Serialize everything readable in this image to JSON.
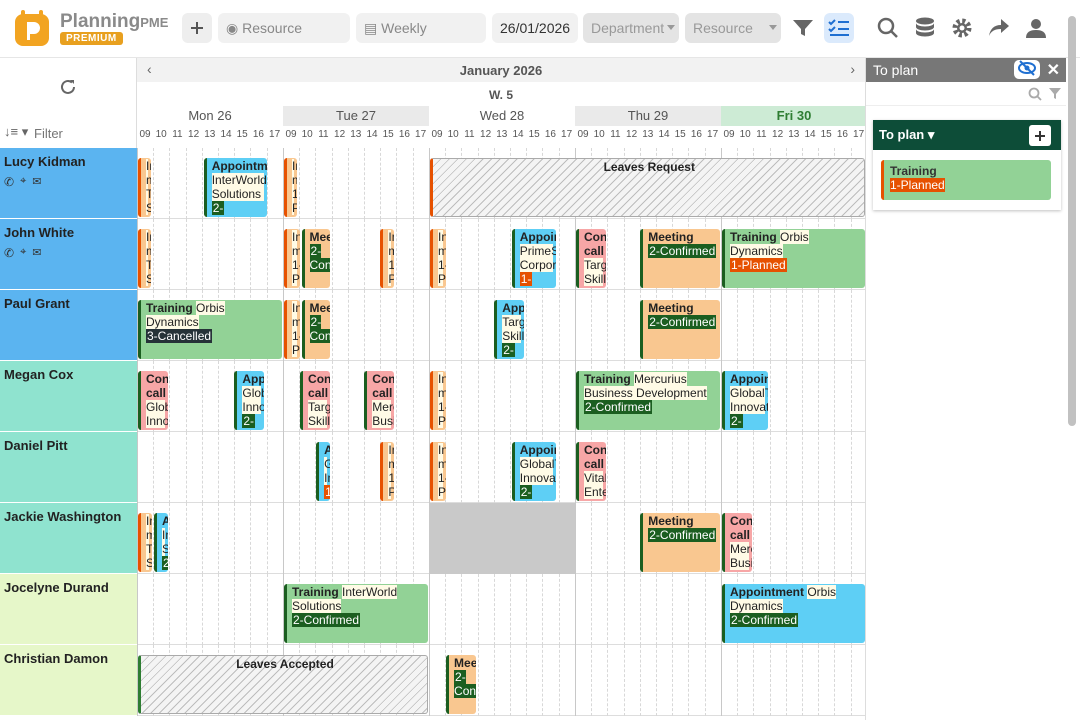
{
  "app": {
    "brand": "Planning",
    "brand_suffix": "PME",
    "badge": "PREMIUM"
  },
  "toolbar": {
    "resource_placeholder": "Resource",
    "view": "Weekly",
    "date": "26/01/2026",
    "department": "Department",
    "resource_select": "Resource"
  },
  "left": {
    "filter_placeholder": "Filter"
  },
  "calendar": {
    "month": "January 2026",
    "week": "W. 5",
    "days": [
      "Mon 26",
      "Tue 27",
      "Wed 28",
      "Thu 29",
      "Fri 30"
    ],
    "hours": [
      "09",
      "10",
      "11",
      "12",
      "13",
      "14",
      "15",
      "16",
      "17"
    ]
  },
  "resources": [
    {
      "name": "Lucy Kidman",
      "group": "blue",
      "contact": true
    },
    {
      "name": "John White",
      "group": "blue",
      "contact": true
    },
    {
      "name": "Paul Grant",
      "group": "blue",
      "contact": false
    },
    {
      "name": "Megan Cox",
      "group": "teal",
      "contact": false
    },
    {
      "name": "Daniel Pitt",
      "group": "teal",
      "contact": false
    },
    {
      "name": "Jackie Washington",
      "group": "teal",
      "contact": false
    },
    {
      "name": "Jocelyne Durand",
      "group": "green",
      "contact": false
    },
    {
      "name": "Christian Damon",
      "group": "green",
      "contact": false
    }
  ],
  "group_colors": {
    "blue": "#5bb4f0",
    "teal": "#8fe3cf",
    "green": "#e6f7c9"
  },
  "events": [
    {
      "row": 0,
      "s": 0.0,
      "e": 0.1,
      "k": "inter",
      "lines": [
        "In",
        "m",
        "Ta",
        "Sk"
      ]
    },
    {
      "row": 0,
      "s": 0.45,
      "e": 0.9,
      "k": "appt",
      "title": "Appointment",
      "lines": [
        "InterWorld",
        "Solutions"
      ],
      "status": "2-",
      "sc": "c"
    },
    {
      "row": 0,
      "s": 1.0,
      "e": 1.1,
      "k": "inter",
      "lines": [
        "In",
        "m",
        "1-",
        "Pl"
      ]
    },
    {
      "row": 0,
      "s": 2.0,
      "e": 4.99,
      "k": "leave",
      "title": "Leaves Request"
    },
    {
      "row": 1,
      "s": 0.0,
      "e": 0.1,
      "k": "inter",
      "lines": [
        "In",
        "m",
        "Ta",
        "Sk"
      ]
    },
    {
      "row": 1,
      "s": 1.0,
      "e": 1.12,
      "k": "inter",
      "lines": [
        "In",
        "m",
        "1-",
        "Pl"
      ]
    },
    {
      "row": 1,
      "s": 1.12,
      "e": 1.33,
      "k": "meet",
      "title": "Meeting",
      "status": "2-Confirmed",
      "sc": "c"
    },
    {
      "row": 1,
      "s": 1.66,
      "e": 1.77,
      "k": "inter",
      "lines": [
        "In",
        "m",
        "1-",
        "Pl"
      ]
    },
    {
      "row": 1,
      "s": 2.0,
      "e": 2.12,
      "k": "inter",
      "lines": [
        "In",
        "m",
        "1-",
        "Pl"
      ]
    },
    {
      "row": 1,
      "s": 2.56,
      "e": 2.88,
      "k": "appt",
      "title": "Appointment",
      "lines": [
        "PrimeSp",
        "Corpora"
      ],
      "status": "1-",
      "sc": "p"
    },
    {
      "row": 1,
      "s": 3.0,
      "e": 3.22,
      "k": "conf",
      "title": "Conference call",
      "lines": [
        "Targ",
        "Skills"
      ]
    },
    {
      "row": 1,
      "s": 3.44,
      "e": 4.0,
      "k": "meet",
      "title": "Meeting",
      "status": "2-Confirmed",
      "sc": "c"
    },
    {
      "row": 1,
      "s": 4.0,
      "e": 4.99,
      "k": "train",
      "title": "Training",
      "extra": "Orbis Dynamics",
      "status": "1-Planned",
      "sc": "p"
    },
    {
      "row": 2,
      "s": 0.0,
      "e": 1.0,
      "k": "train",
      "title": "Training",
      "extra": "Orbis Dynamics",
      "status": "3-Cancelled",
      "sc": "x"
    },
    {
      "row": 2,
      "s": 1.0,
      "e": 1.12,
      "k": "inter",
      "lines": [
        "In",
        "m",
        "1-",
        "Pl"
      ]
    },
    {
      "row": 2,
      "s": 1.12,
      "e": 1.33,
      "k": "meet",
      "title": "Meeting",
      "status": "2-Confirmed",
      "sc": "c"
    },
    {
      "row": 2,
      "s": 2.44,
      "e": 2.66,
      "k": "appt",
      "title": "Appointment",
      "lines": [
        "Targ",
        "Skills"
      ],
      "status": "2-",
      "sc": "c"
    },
    {
      "row": 2,
      "s": 3.44,
      "e": 4.0,
      "k": "meet",
      "title": "Meeting",
      "status": "2-Confirmed",
      "sc": "c"
    },
    {
      "row": 3,
      "s": 0.0,
      "e": 0.22,
      "k": "conf",
      "title": "Conference call",
      "lines": [
        "Glob",
        "Innov"
      ]
    },
    {
      "row": 3,
      "s": 0.66,
      "e": 0.88,
      "k": "appt",
      "title": "Appointment",
      "lines": [
        "Glob",
        "Inno"
      ],
      "status": "2-",
      "sc": "c"
    },
    {
      "row": 3,
      "s": 1.11,
      "e": 1.33,
      "k": "conf",
      "title": "Conference call",
      "lines": [
        "Targ",
        "Skills"
      ]
    },
    {
      "row": 3,
      "s": 1.55,
      "e": 1.77,
      "k": "conf",
      "title": "Conference call",
      "lines": [
        "Merc",
        "Busi"
      ]
    },
    {
      "row": 3,
      "s": 2.0,
      "e": 2.12,
      "k": "inter",
      "lines": [
        "In",
        "m",
        "1-",
        "Pl"
      ]
    },
    {
      "row": 3,
      "s": 3.0,
      "e": 4.0,
      "k": "train",
      "title": "Training",
      "extra": "Mercurius Business Development",
      "status": "2-Confirmed",
      "sc": "c"
    },
    {
      "row": 3,
      "s": 4.0,
      "e": 4.33,
      "k": "appt",
      "title": "Appointment",
      "lines": [
        "GlobalT",
        "Innovati"
      ],
      "status": "2-",
      "sc": "c"
    },
    {
      "row": 4,
      "s": 1.22,
      "e": 1.33,
      "k": "appt",
      "title": "Ap",
      "lines": [
        "G",
        "In"
      ],
      "status": "1-",
      "sc": "p"
    },
    {
      "row": 4,
      "s": 1.66,
      "e": 1.77,
      "k": "inter",
      "lines": [
        "In",
        "m",
        "1-",
        "Pl"
      ]
    },
    {
      "row": 4,
      "s": 2.0,
      "e": 2.12,
      "k": "inter",
      "lines": [
        "In",
        "m",
        "1-",
        "Pl"
      ]
    },
    {
      "row": 4,
      "s": 2.56,
      "e": 2.88,
      "k": "appt",
      "title": "Appointment",
      "lines": [
        "GlobalT",
        "Innovati"
      ],
      "status": "2-",
      "sc": "c"
    },
    {
      "row": 4,
      "s": 3.0,
      "e": 3.22,
      "k": "conf",
      "title": "Conference call",
      "lines": [
        "VitaN",
        "Ente"
      ]
    },
    {
      "row": 5,
      "s": 0.0,
      "e": 0.11,
      "k": "inter",
      "lines": [
        "In",
        "m",
        "Ta",
        "Sk"
      ]
    },
    {
      "row": 5,
      "s": 0.11,
      "e": 0.22,
      "k": "appt",
      "title": "A",
      "lines": [
        "In",
        "Sc"
      ],
      "status": "2-",
      "sc": "c"
    },
    {
      "row": 5,
      "s": 3.44,
      "e": 4.0,
      "k": "meet",
      "title": "Meeting",
      "status": "2-Confirmed",
      "sc": "c"
    },
    {
      "row": 5,
      "s": 4.0,
      "e": 4.22,
      "k": "conf",
      "title": "Conference call",
      "lines": [
        "Merc",
        "Busi"
      ]
    },
    {
      "row": 6,
      "s": 1.0,
      "e": 2.0,
      "k": "train",
      "title": "Training",
      "extra": "InterWorld Solutions",
      "status": "2-Confirmed",
      "sc": "c"
    },
    {
      "row": 6,
      "s": 4.0,
      "e": 4.99,
      "k": "appt",
      "title": "Appointment",
      "extra": "Orbis Dynamics",
      "status": "2-Confirmed",
      "sc": "c"
    },
    {
      "row": 7,
      "s": 0.0,
      "e": 2.0,
      "k": "leave acc",
      "title": "Leaves Accepted"
    },
    {
      "row": 7,
      "s": 2.11,
      "e": 2.33,
      "k": "meet",
      "title": "Meeting",
      "status": "2-Confirmed",
      "sc": "c"
    }
  ],
  "blocked": [
    {
      "row": 5,
      "s": 2.0,
      "e": 3.0
    }
  ],
  "side": {
    "title": "To plan",
    "section": "To plan",
    "item_title": "Training",
    "item_status": "1-Planned"
  }
}
